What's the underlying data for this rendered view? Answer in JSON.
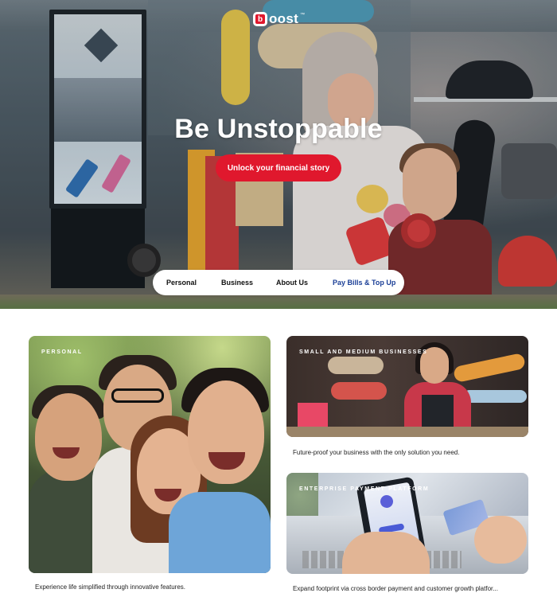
{
  "brand": {
    "logo_letter": "b",
    "logo_word": "oost",
    "logo_tm": "™",
    "accent_color": "#e0182d",
    "nav_accent_color": "#1b3f97"
  },
  "hero": {
    "title": "Be Unstoppable",
    "cta_label": "Unlock your financial story"
  },
  "nav": {
    "items": [
      {
        "label": "Personal"
      },
      {
        "label": "Business"
      },
      {
        "label": "About Us"
      },
      {
        "label": "Pay Bills & Top Up"
      }
    ]
  },
  "cards": {
    "personal": {
      "tag": "PERSONAL",
      "caption": "Experience life simplified through innovative features."
    },
    "sme": {
      "tag": "SMALL AND MEDIUM BUSINESSES",
      "caption": "Future-proof your business with the only solution you need."
    },
    "enterprise": {
      "tag": "ENTERPRISE PAYMENT PLATFORM",
      "caption": "Expand footprint via cross border payment and customer growth platfor..."
    }
  }
}
